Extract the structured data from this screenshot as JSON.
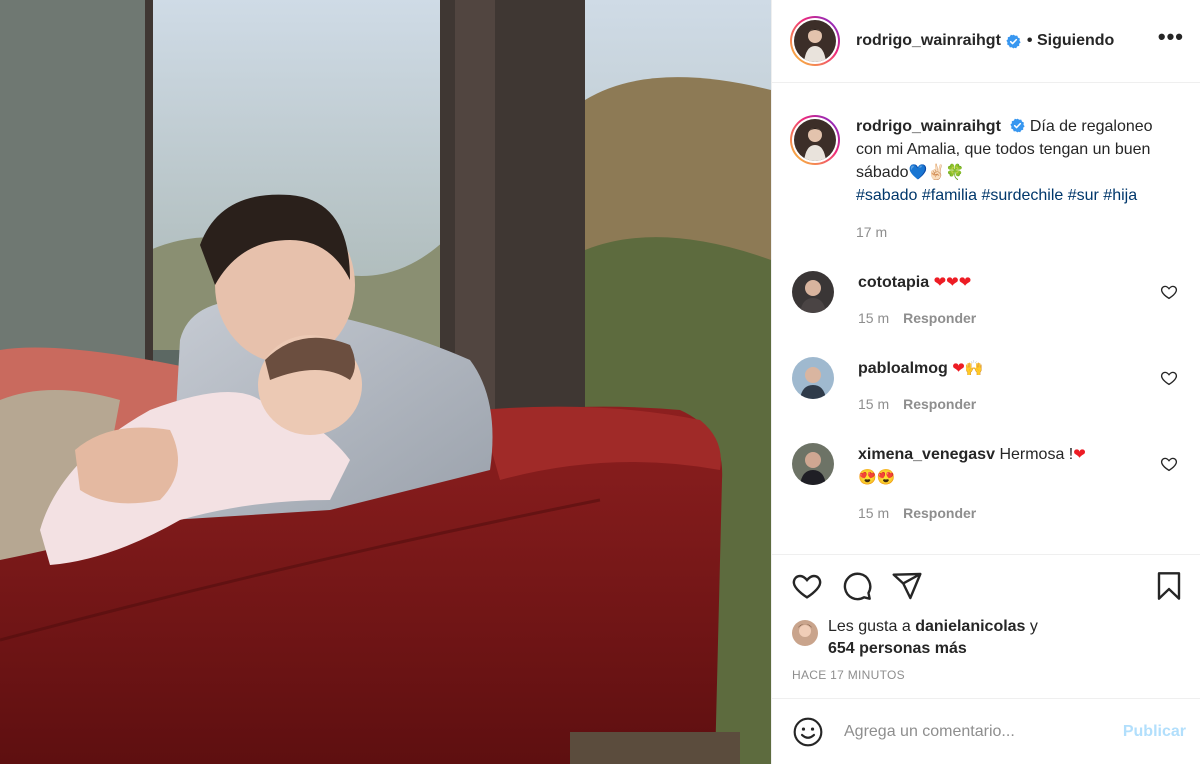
{
  "header": {
    "username": "rodrigo_wainraihgt",
    "follow_state": "• Siguiendo",
    "more_label": "•••"
  },
  "caption": {
    "username": "rodrigo_wainraihgt",
    "text": "Día de regaloneo con mi Amalia, que todos tengan un buen sábado",
    "emojis": "💙✌🏻🍀",
    "hashtags": [
      "#sabado",
      "#familia",
      "#surdechile",
      "#sur",
      "#hija"
    ],
    "time": "17 m"
  },
  "comments": [
    {
      "username": "cototapia",
      "text": "",
      "emojis": "❤❤❤",
      "time": "15 m",
      "reply": "Responder"
    },
    {
      "username": "pabloalmog",
      "text": "",
      "emojis": "❤🙌",
      "time": "15 m",
      "reply": "Responder"
    },
    {
      "username": "ximena_venegasv",
      "text": "Hermosa !",
      "emojis": "❤",
      "emojis2": "😍😍",
      "time": "15 m",
      "reply": "Responder"
    }
  ],
  "likes": {
    "prefix": "Les gusta a",
    "user": "danielanicolas",
    "joiner": "y",
    "count_text": "654 personas más"
  },
  "timestamp": "HACE 17 MINUTOS",
  "comment_box": {
    "placeholder": "Agrega un comentario...",
    "publish_label": "Publicar"
  },
  "colors": {
    "verified": "#3897f0",
    "link": "#00376b",
    "muted": "#8e8e8e",
    "publish_disabled": "#b2dffc"
  },
  "icons": [
    "verified-icon",
    "heart-icon",
    "comment-icon",
    "share-icon",
    "bookmark-icon",
    "emoji-icon"
  ]
}
